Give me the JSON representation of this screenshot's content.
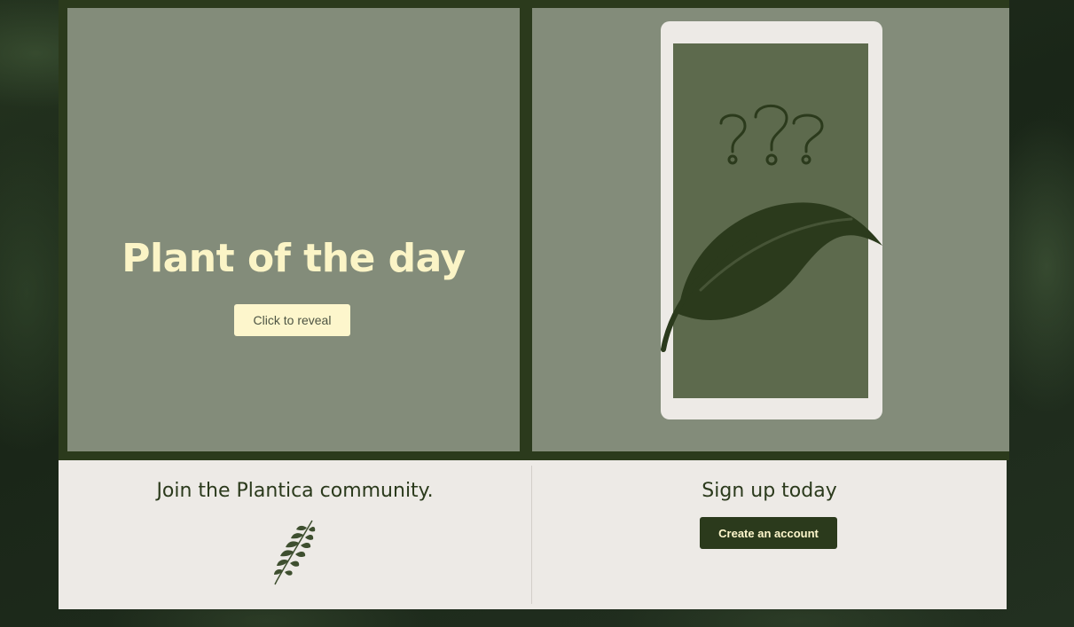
{
  "hero": {
    "title": "Plant of the day",
    "reveal_label": "Click to reveal",
    "mystery_icon": "phone-with-leaf-and-question-marks"
  },
  "community": {
    "title": "Join the Plantica community.",
    "icon": "fern-leaf-icon"
  },
  "signup": {
    "title": "Sign up today",
    "button_label": "Create an account"
  },
  "colors": {
    "dark_green": "#2b3a1c",
    "panel_sage": "#838c7a",
    "cream": "#fbf4c6",
    "light_panel": "#edeae6",
    "phone_screen": "#5d6a4d"
  }
}
